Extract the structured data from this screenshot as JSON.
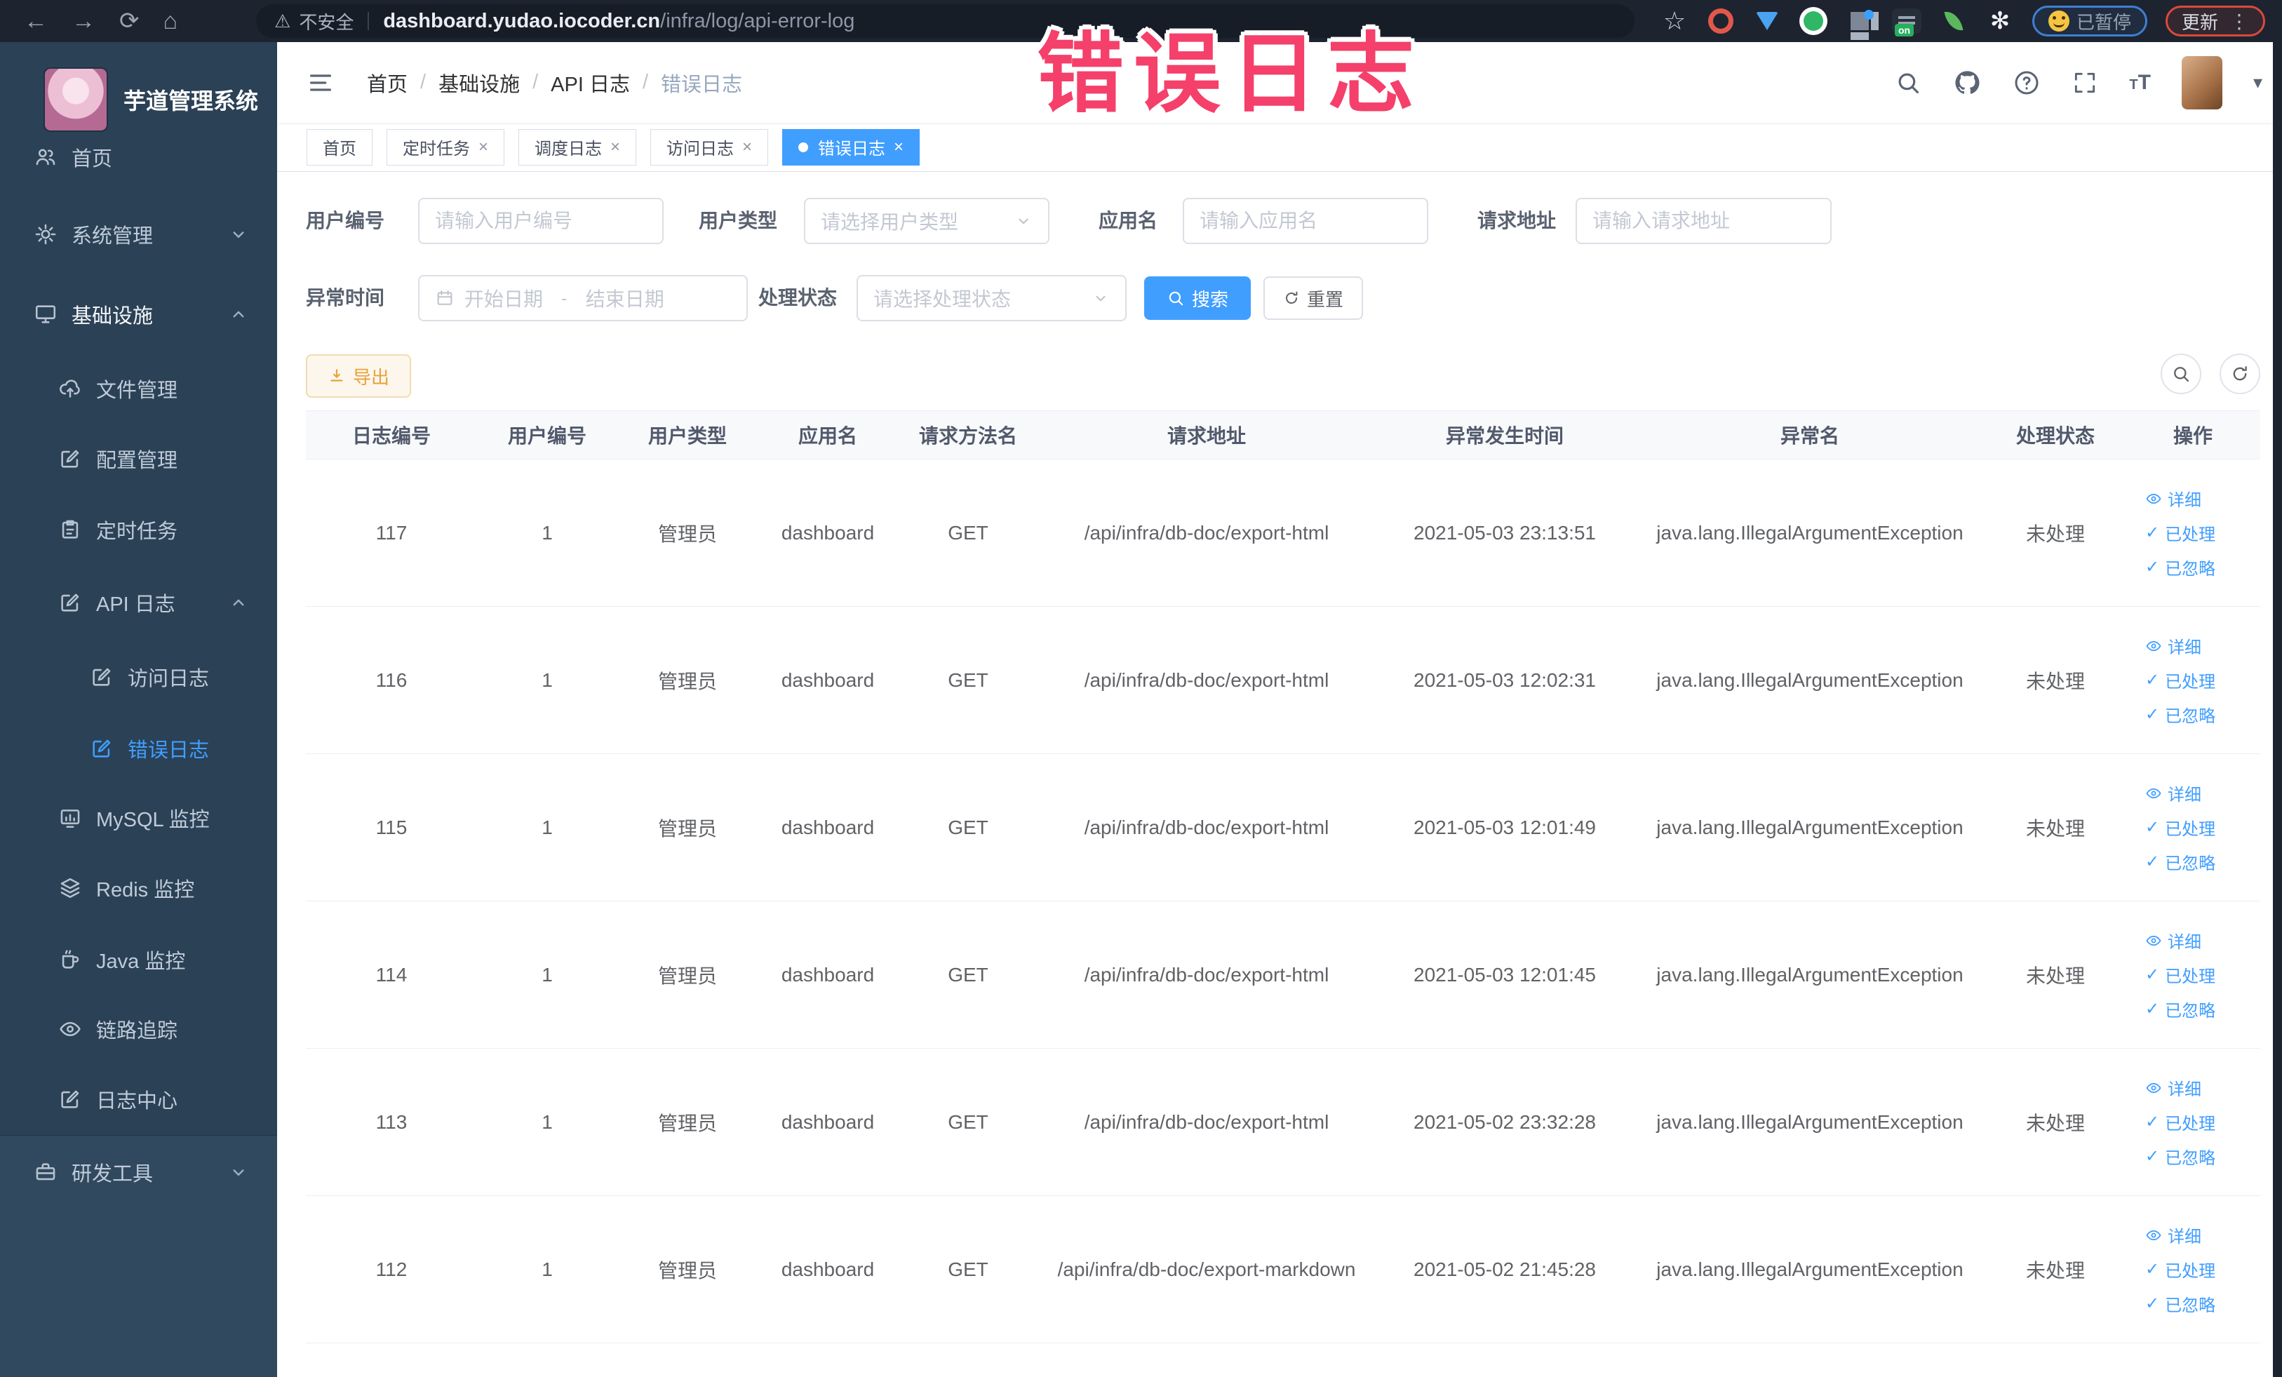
{
  "browser": {
    "security_label": "不安全",
    "url_host": "dashboard.yudao.iocoder.cn",
    "url_path": "/infra/log/api-error-log",
    "paused_badge": "已暂停",
    "update_badge": "更新"
  },
  "icons": {
    "back": "←",
    "forward": "→",
    "reload": "⟳",
    "home": "⌂",
    "warning": "⚠",
    "star": "☆",
    "more": "⋮",
    "caret": "▾",
    "check": "✓",
    "close": "×",
    "on_badge": "on"
  },
  "annotation": {
    "title": "错误日志"
  },
  "sidebar": {
    "app_title": "芋道管理系统",
    "items": [
      {
        "label": "首页",
        "icon": "users-icon"
      },
      {
        "label": "系统管理",
        "icon": "gear-icon",
        "chevron": "down"
      },
      {
        "label": "基础设施",
        "icon": "monitor-icon",
        "chevron": "up"
      },
      {
        "label": "文件管理",
        "icon": "cloud-upload-icon"
      },
      {
        "label": "配置管理",
        "icon": "edit-icon"
      },
      {
        "label": "定时任务",
        "icon": "clipboard-icon"
      },
      {
        "label": "API 日志",
        "icon": "edit-icon",
        "chevron": "up"
      },
      {
        "label": "访问日志",
        "icon": "edit-icon"
      },
      {
        "label": "错误日志",
        "icon": "edit-icon",
        "active": true
      },
      {
        "label": "MySQL 监控",
        "icon": "chart-icon"
      },
      {
        "label": "Redis 监控",
        "icon": "layers-icon"
      },
      {
        "label": "Java 监控",
        "icon": "mug-icon"
      },
      {
        "label": "链路追踪",
        "icon": "eye-icon"
      },
      {
        "label": "日志中心",
        "icon": "edit-icon"
      },
      {
        "label": "研发工具",
        "icon": "toolbox-icon",
        "chevron": "down"
      }
    ]
  },
  "header": {
    "breadcrumb": [
      "首页",
      "基础设施",
      "API 日志",
      "错误日志"
    ],
    "separator": "/"
  },
  "tabs": [
    {
      "label": "首页"
    },
    {
      "label": "定时任务"
    },
    {
      "label": "调度日志"
    },
    {
      "label": "访问日志"
    },
    {
      "label": "错误日志"
    }
  ],
  "filters": {
    "user_id_label": "用户编号",
    "user_id_placeholder": "请输入用户编号",
    "user_type_label": "用户类型",
    "user_type_placeholder": "请选择用户类型",
    "app_name_label": "应用名",
    "app_name_placeholder": "请输入应用名",
    "request_url_label": "请求地址",
    "request_url_placeholder": "请输入请求地址",
    "exception_time_label": "异常时间",
    "date_start_placeholder": "开始日期",
    "date_separator": "-",
    "date_end_placeholder": "结束日期",
    "process_status_label": "处理状态",
    "process_status_placeholder": "请选择处理状态",
    "search_button": "搜索",
    "reset_button": "重置"
  },
  "toolbar": {
    "export_label": "导出"
  },
  "table": {
    "headers": [
      "日志编号",
      "用户编号",
      "用户类型",
      "应用名",
      "请求方法名",
      "请求地址",
      "异常发生时间",
      "异常名",
      "处理状态",
      "操作"
    ],
    "actions": {
      "detail": "详细",
      "processed": "已处理",
      "ignored": "已忽略"
    },
    "rows": [
      {
        "log_id": "117",
        "user_id": "1",
        "user_type": "管理员",
        "app_name": "dashboard",
        "method": "GET",
        "url": "/api/infra/db-doc/export-html",
        "time": "2021-05-03 23:13:51",
        "exception": "java.lang.IllegalArgumentException",
        "status": "未处理"
      },
      {
        "log_id": "116",
        "user_id": "1",
        "user_type": "管理员",
        "app_name": "dashboard",
        "method": "GET",
        "url": "/api/infra/db-doc/export-html",
        "time": "2021-05-03 12:02:31",
        "exception": "java.lang.IllegalArgumentException",
        "status": "未处理"
      },
      {
        "log_id": "115",
        "user_id": "1",
        "user_type": "管理员",
        "app_name": "dashboard",
        "method": "GET",
        "url": "/api/infra/db-doc/export-html",
        "time": "2021-05-03 12:01:49",
        "exception": "java.lang.IllegalArgumentException",
        "status": "未处理"
      },
      {
        "log_id": "114",
        "user_id": "1",
        "user_type": "管理员",
        "app_name": "dashboard",
        "method": "GET",
        "url": "/api/infra/db-doc/export-html",
        "time": "2021-05-03 12:01:45",
        "exception": "java.lang.IllegalArgumentException",
        "status": "未处理"
      },
      {
        "log_id": "113",
        "user_id": "1",
        "user_type": "管理员",
        "app_name": "dashboard",
        "method": "GET",
        "url": "/api/infra/db-doc/export-html",
        "time": "2021-05-02 23:32:28",
        "exception": "java.lang.IllegalArgumentException",
        "status": "未处理"
      },
      {
        "log_id": "112",
        "user_id": "1",
        "user_type": "管理员",
        "app_name": "dashboard",
        "method": "GET",
        "url": "/api/infra/db-doc/export-markdown",
        "time": "2021-05-02 21:45:28",
        "exception": "java.lang.IllegalArgumentException",
        "status": "未处理"
      }
    ]
  }
}
